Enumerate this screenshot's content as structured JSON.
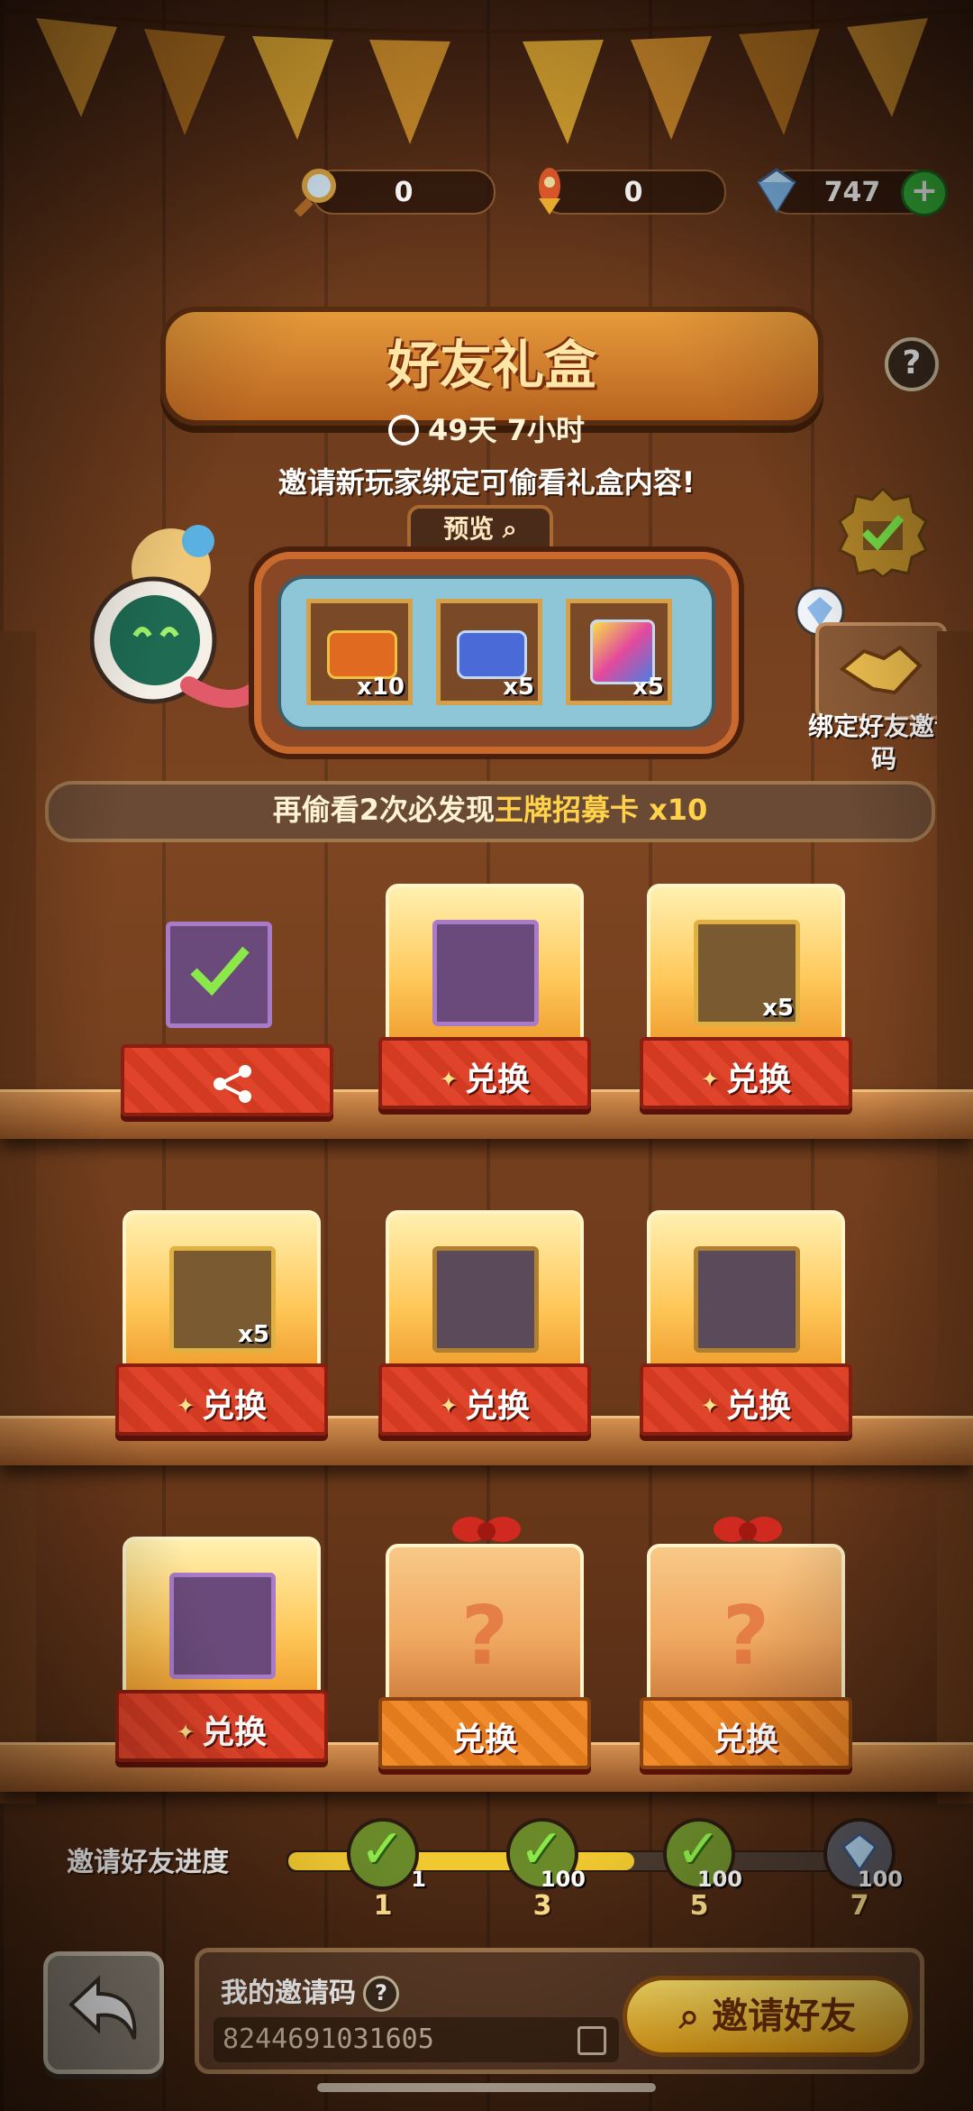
{
  "currency": {
    "magnifier": "0",
    "rocket": "0",
    "diamond": "747",
    "add_label": "+"
  },
  "header": {
    "title": "好友礼盒",
    "help": "?",
    "timer": "49天 7小时",
    "subtitle": "邀请新玩家绑定可偷看礼盒内容!"
  },
  "preview": {
    "tab_label": "预览",
    "slots": [
      {
        "count": "x10"
      },
      {
        "count": "x5"
      },
      {
        "count": "x5"
      }
    ]
  },
  "bind": {
    "label": "绑定好友邀请码"
  },
  "hint": {
    "prefix": "再偷看2次必发现",
    "highlight": "王牌招募卡",
    "suffix": "x10"
  },
  "shelf_rows": [
    [
      {
        "type": "claimed",
        "label": ""
      },
      {
        "type": "exchange",
        "label": "兑换",
        "count": ""
      },
      {
        "type": "exchange",
        "label": "兑换",
        "count": "x5"
      }
    ],
    [
      {
        "type": "exchange",
        "label": "兑换",
        "count": "x5"
      },
      {
        "type": "exchange",
        "label": "兑换",
        "count": ""
      },
      {
        "type": "exchange",
        "label": "兑换",
        "count": ""
      }
    ],
    [
      {
        "type": "exchange",
        "label": "兑换",
        "count": ""
      },
      {
        "type": "mystery",
        "label": "兑换",
        "count": ""
      },
      {
        "type": "mystery",
        "label": "兑换",
        "count": ""
      }
    ]
  ],
  "progress": {
    "label": "邀请好友进度",
    "fill_fraction": 0.6,
    "nodes": [
      {
        "num": "1",
        "reward": "1",
        "done": true
      },
      {
        "num": "3",
        "reward": "100",
        "done": true
      },
      {
        "num": "5",
        "reward": "100",
        "done": true
      },
      {
        "num": "7",
        "reward": "100",
        "done": false
      }
    ]
  },
  "footer": {
    "code_label": "我的邀请码",
    "code_help": "?",
    "code_value": "8244691031605",
    "invite_label": "邀请好友"
  }
}
